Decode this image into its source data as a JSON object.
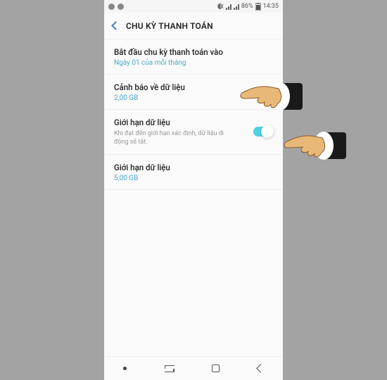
{
  "statusbar": {
    "battery": "86%",
    "time": "14:35"
  },
  "header": {
    "title": "CHU KỲ THANH TOÁN"
  },
  "items": {
    "billing_cycle": {
      "title": "Bắt đầu chu kỳ thanh toán vào",
      "sub": "Ngày 01 của mỗi tháng"
    },
    "data_warning": {
      "title": "Cảnh báo về dữ liệu",
      "sub": "2,00 GB"
    },
    "data_limit_toggle": {
      "title": "Giới hạn dữ liệu",
      "desc": "Khi đạt đến giới hạn xác định, dữ liệu di động sẽ tắt."
    },
    "data_limit_value": {
      "title": "Giới hạn dữ liệu",
      "sub": "5,00 GB"
    }
  }
}
